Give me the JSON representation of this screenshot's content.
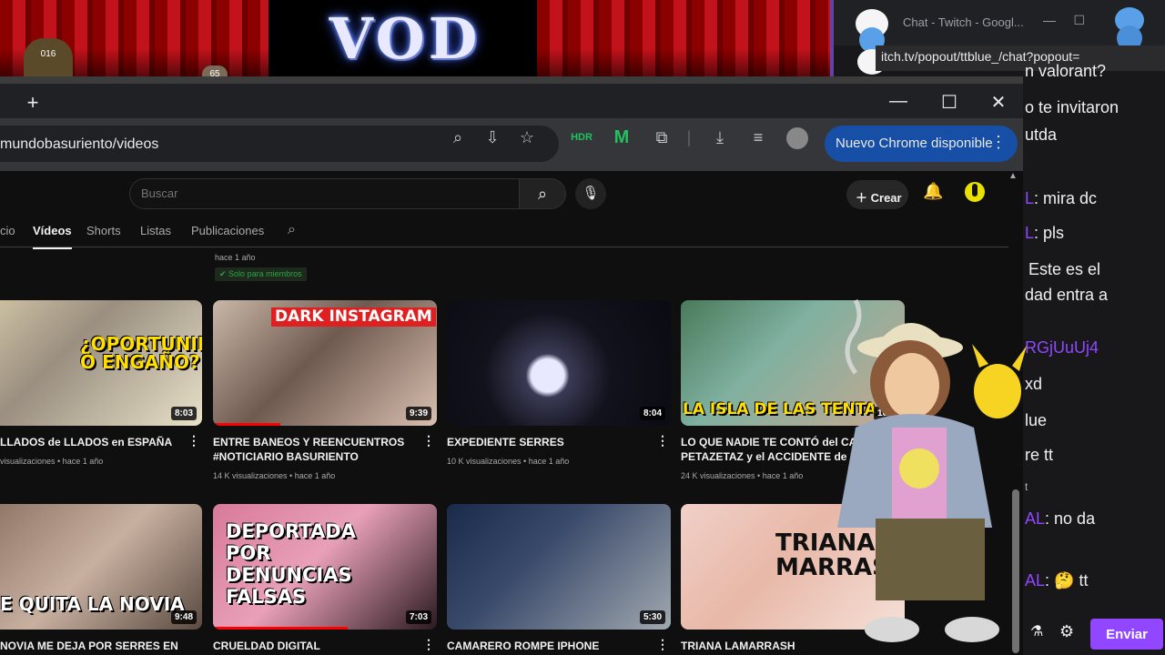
{
  "stream_overlay": {
    "logo_text": "VOD",
    "cat_badge": "016",
    "small_badge": "65"
  },
  "chat_window": {
    "title": "Chat - Twitch - Googl...",
    "url": "itch.tv/popout/ttblue_/chat?popout=",
    "lines": [
      {
        "name": "",
        "text": "n valorant?"
      },
      {
        "name": "",
        "text": "o te invitaron"
      },
      {
        "name": "",
        "text": "utda"
      },
      {
        "name": "L",
        "text": ": mira dc"
      },
      {
        "name": "L",
        "text": ": pls"
      },
      {
        "name": "",
        "text": "Este es el"
      },
      {
        "name": "",
        "text": "dad entra a"
      },
      {
        "name": "RGjUuUj4",
        "text": ""
      },
      {
        "name": "",
        "text": "xd"
      },
      {
        "name": "",
        "text": "lue"
      },
      {
        "name": "",
        "text": "re tt"
      },
      {
        "name": "",
        "text": "t"
      },
      {
        "name": "AL",
        "text": ": no da"
      },
      {
        "name": "AL",
        "text": ": 🤔 tt"
      }
    ],
    "send_label": "Enviar"
  },
  "browser": {
    "new_tab": "+",
    "url": "mundobasuriento/videos",
    "update_label": "Nuevo Chrome disponible"
  },
  "youtube": {
    "search_placeholder": "Buscar",
    "create_label": "Crear",
    "tabs": [
      "cio",
      "Vídeos",
      "Shorts",
      "Listas",
      "Publicaciones"
    ],
    "prev_meta": "hace 1 año",
    "members_only": "Solo para miembros",
    "videos": [
      {
        "title": "LLADOS de LLADOS en ESPAÑA",
        "meta": "visualizaciones • hace 1 año",
        "duration": "8:03",
        "overlay": "¿OPORTUNIDAD O ENGAÑO?"
      },
      {
        "title": "ENTRE BANEOS Y REENCUENTROS #NOTICIARIO BASURIENTO",
        "meta": "14 K visualizaciones • hace 1 año",
        "duration": "9:39",
        "overlay": "DARK INSTAGRAM"
      },
      {
        "title": "EXPEDIENTE SERRES",
        "meta": "10 K visualizaciones • hace 1 año",
        "duration": "8:04",
        "overlay": ""
      },
      {
        "title": "LO QUE NADIE TE CONTÓ del CASO PETAZETAZ y el ACCIDENTE de SER",
        "meta": "24 K visualizaciones • hace 1 año",
        "duration": "10:0",
        "overlay": "LA ISLA DE LAS TENTA"
      },
      {
        "title": "NOVIA ME DEJA POR SERRES EN",
        "meta": "",
        "duration": "9:48",
        "overlay": "E QUITA LA NOVIA"
      },
      {
        "title": "CRUELDAD DIGITAL",
        "meta": "",
        "duration": "7:03",
        "overlay": "DEPORTADA POR DENUNCIAS FALSAS"
      },
      {
        "title": "CAMARERO ROMPE IPHONE",
        "meta": "",
        "duration": "5:30",
        "overlay": ""
      },
      {
        "title": "TRIANA LAMARRASH",
        "meta": "",
        "duration": "",
        "overlay": "TRIANA MARRASH"
      }
    ]
  },
  "colors": {
    "twitch_purple": "#9147ff",
    "chrome_update_blue": "#174ea6",
    "yt_bg": "#0f0f0f",
    "progress_red": "#ff0000"
  }
}
